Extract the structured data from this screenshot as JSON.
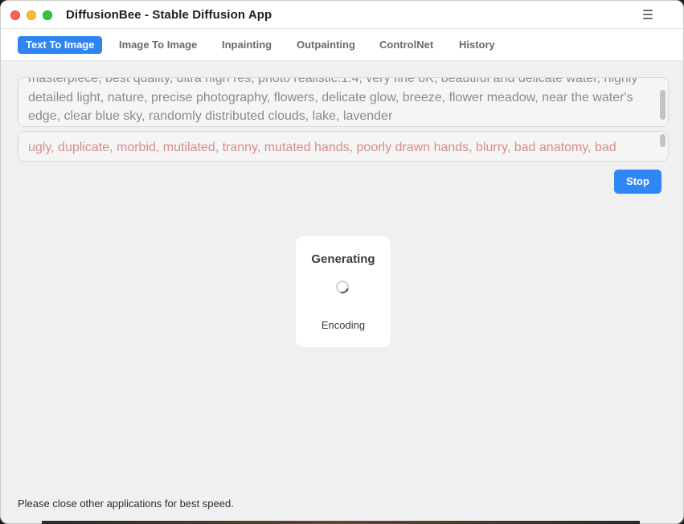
{
  "window": {
    "title": "DiffusionBee - Stable Diffusion App"
  },
  "tabs": [
    {
      "label": "Text To Image",
      "active": true
    },
    {
      "label": "Image To Image",
      "active": false
    },
    {
      "label": "Inpainting",
      "active": false
    },
    {
      "label": "Outpainting",
      "active": false
    },
    {
      "label": "ControlNet",
      "active": false
    },
    {
      "label": "History",
      "active": false
    }
  ],
  "prompt": {
    "text": "masterpiece, best quality, ultra high res, photo realistic:1.4, very fine 8K, beautiful and delicate water, highly detailed light, nature, precise photography, flowers, delicate glow, breeze, flower meadow, near the water's edge, clear blue sky, randomly distributed clouds, lake, lavender"
  },
  "negative_prompt": {
    "text": "ugly, duplicate, morbid, mutilated, tranny, mutated hands, poorly drawn hands, blurry, bad anatomy, bad proportions, extra limbs, cloned face, disfigured, gross proportions, malformed limbs, missing arms"
  },
  "actions": {
    "stop_label": "Stop"
  },
  "progress": {
    "title": "Generating",
    "status": "Encoding"
  },
  "footer": {
    "note": "Please close other applications for best speed."
  },
  "colors": {
    "accent": "#2e84f3",
    "negative_text": "#d88c8e",
    "prompt_text": "#8b8b8b"
  },
  "icons": {
    "menu": "hamburger-menu-icon",
    "spinner": "loading-spinner-icon"
  }
}
